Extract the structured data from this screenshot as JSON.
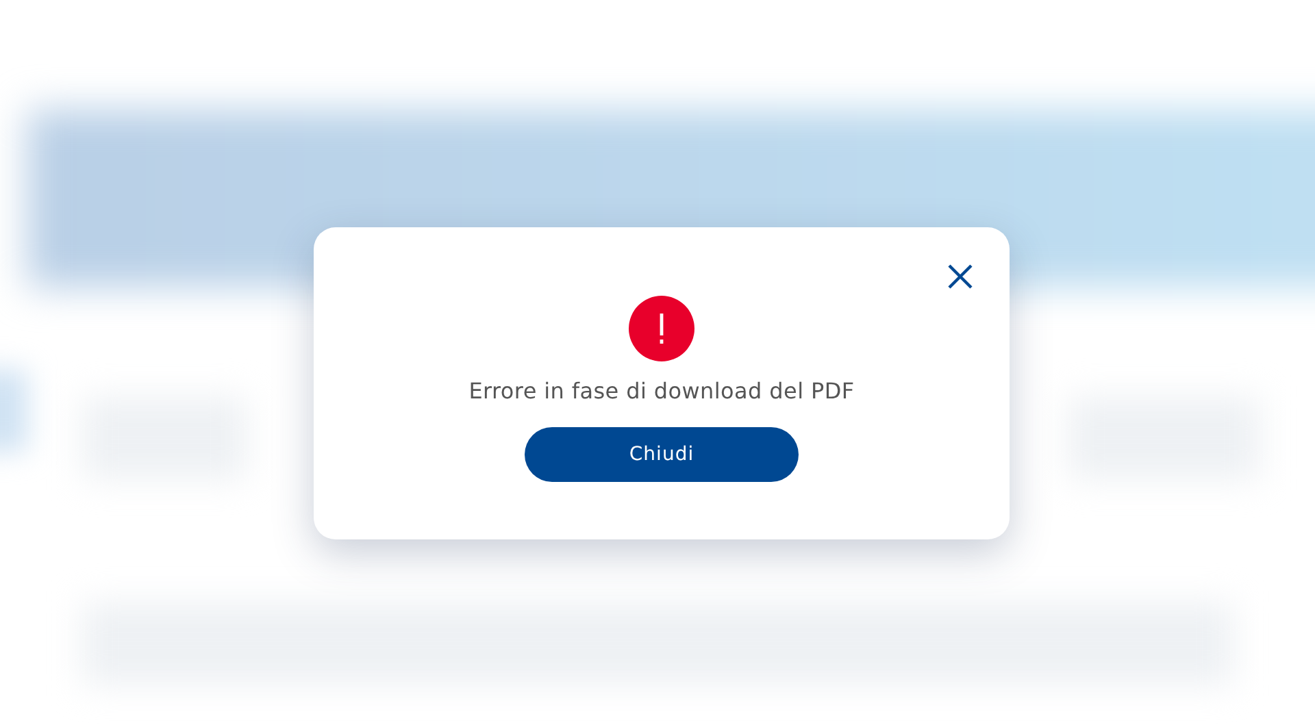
{
  "dialog": {
    "message": "Errore in fase di download del PDF",
    "button": "Chiudi"
  }
}
